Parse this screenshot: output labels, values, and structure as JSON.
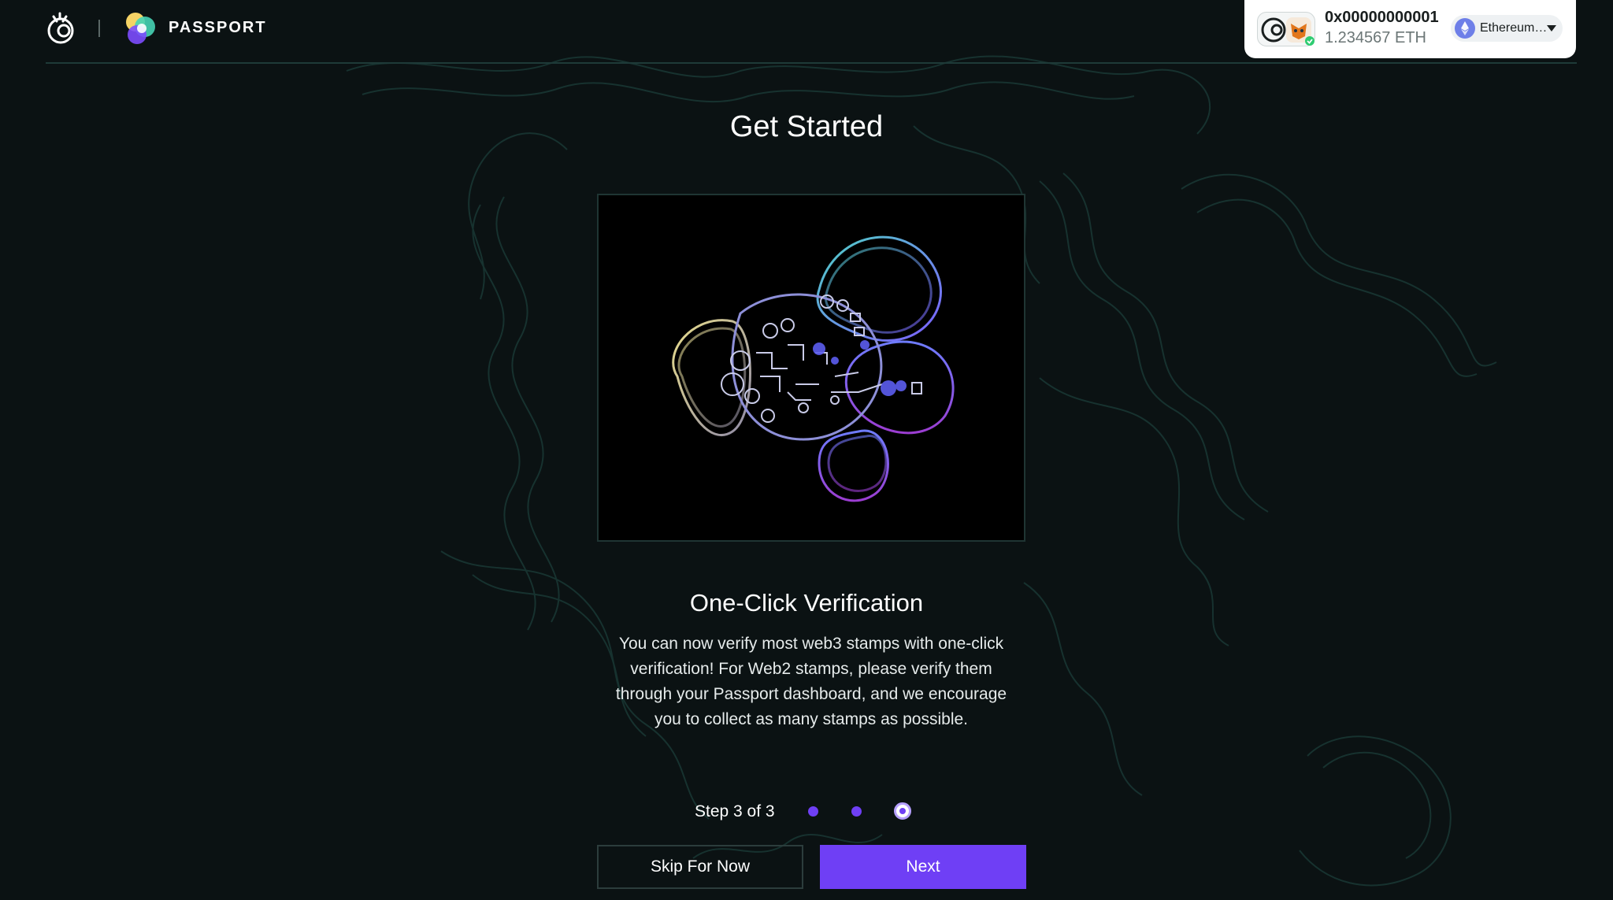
{
  "header": {
    "brand": "PASSPORT"
  },
  "wallet": {
    "address": "0x00000000001",
    "balance": "1.234567 ETH",
    "network": "Ethereum…"
  },
  "main": {
    "title": "Get Started",
    "section_title": "One-Click Verification",
    "description": "You can now verify most web3 stamps with one-click verification! For Web2 stamps, please verify them through your Passport dashboard, and we encourage you to collect as many stamps as possible."
  },
  "stepper": {
    "label": "Step 3 of 3",
    "current": 3,
    "total": 3
  },
  "actions": {
    "skip_label": "Skip For Now",
    "next_label": "Next"
  },
  "colors": {
    "background": "#0b1213",
    "accent": "#6f3ff5",
    "topo_line": "#1f4a45"
  }
}
